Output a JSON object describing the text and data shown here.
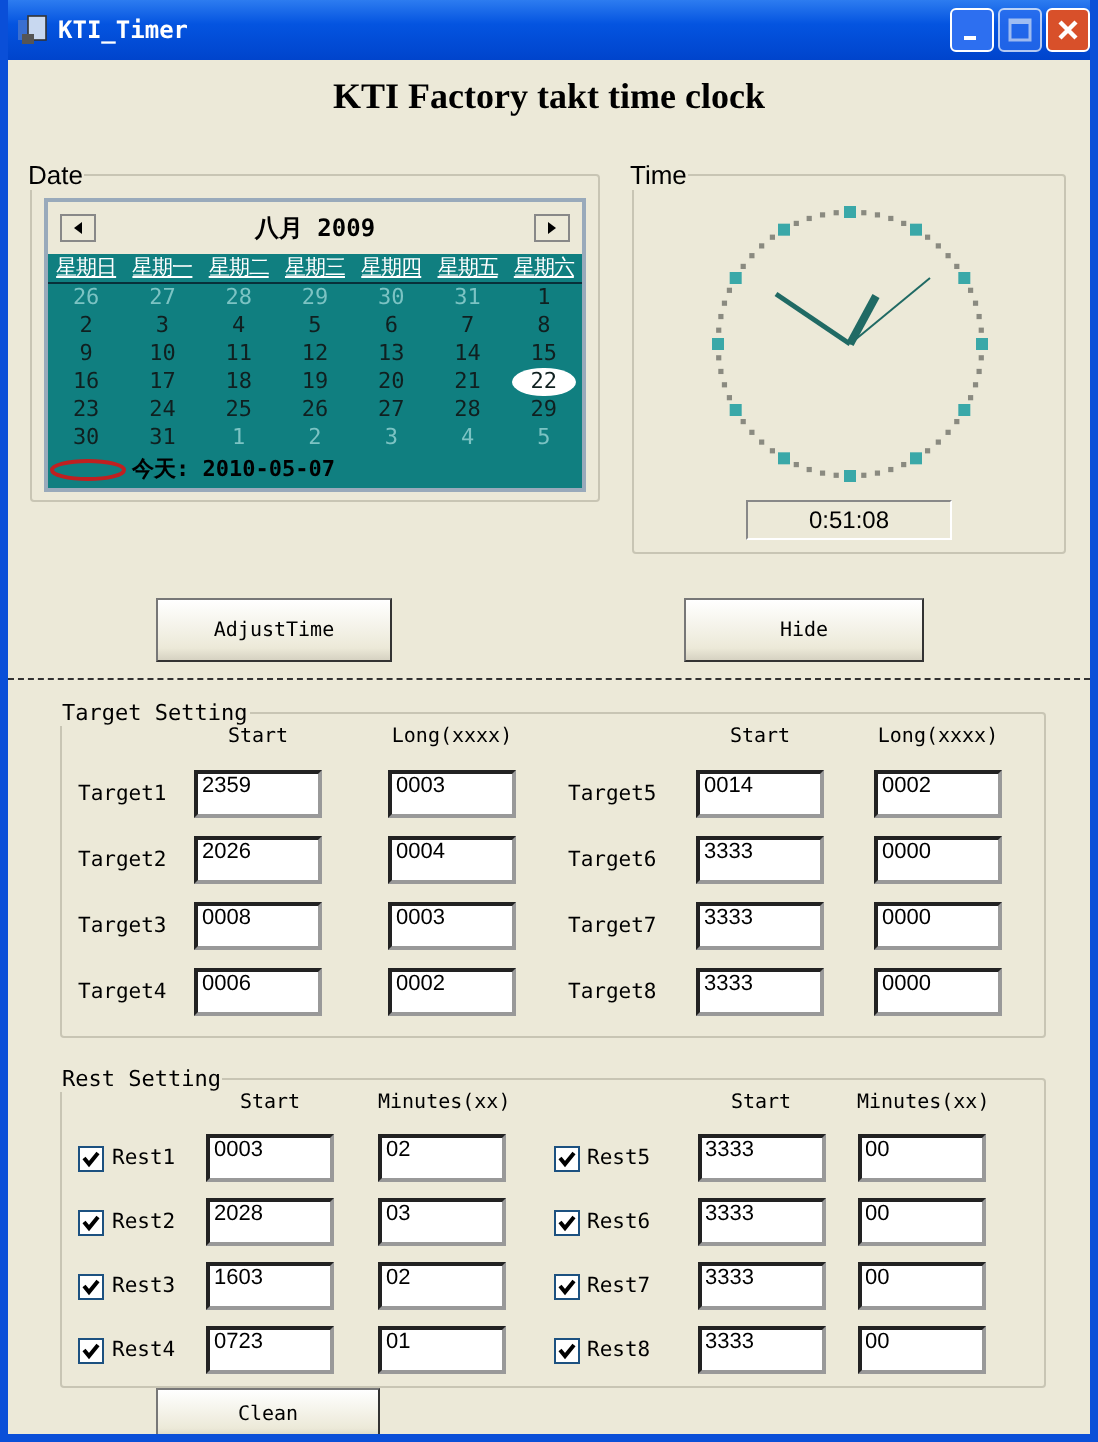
{
  "window": {
    "title": "KTI_Timer"
  },
  "heading": "KTI Factory takt time clock",
  "date_group": {
    "title": "Date",
    "calendar": {
      "month_label": "八月 2009",
      "weekdays": [
        "星期日",
        "星期一",
        "星期二",
        "星期三",
        "星期四",
        "星期五",
        "星期六"
      ],
      "weeks": [
        [
          {
            "text": "26",
            "other_month": true,
            "selected": false
          },
          {
            "text": "27",
            "other_month": true,
            "selected": false
          },
          {
            "text": "28",
            "other_month": true,
            "selected": false
          },
          {
            "text": "29",
            "other_month": true,
            "selected": false
          },
          {
            "text": "30",
            "other_month": true,
            "selected": false
          },
          {
            "text": "31",
            "other_month": true,
            "selected": false
          },
          {
            "text": "1",
            "other_month": false,
            "selected": false
          }
        ],
        [
          {
            "text": "2",
            "other_month": false,
            "selected": false
          },
          {
            "text": "3",
            "other_month": false,
            "selected": false
          },
          {
            "text": "4",
            "other_month": false,
            "selected": false
          },
          {
            "text": "5",
            "other_month": false,
            "selected": false
          },
          {
            "text": "6",
            "other_month": false,
            "selected": false
          },
          {
            "text": "7",
            "other_month": false,
            "selected": false
          },
          {
            "text": "8",
            "other_month": false,
            "selected": false
          }
        ],
        [
          {
            "text": "9",
            "other_month": false,
            "selected": false
          },
          {
            "text": "10",
            "other_month": false,
            "selected": false
          },
          {
            "text": "11",
            "other_month": false,
            "selected": false
          },
          {
            "text": "12",
            "other_month": false,
            "selected": false
          },
          {
            "text": "13",
            "other_month": false,
            "selected": false
          },
          {
            "text": "14",
            "other_month": false,
            "selected": false
          },
          {
            "text": "15",
            "other_month": false,
            "selected": false
          }
        ],
        [
          {
            "text": "16",
            "other_month": false,
            "selected": false
          },
          {
            "text": "17",
            "other_month": false,
            "selected": false
          },
          {
            "text": "18",
            "other_month": false,
            "selected": false
          },
          {
            "text": "19",
            "other_month": false,
            "selected": false
          },
          {
            "text": "20",
            "other_month": false,
            "selected": false
          },
          {
            "text": "21",
            "other_month": false,
            "selected": false
          },
          {
            "text": "22",
            "other_month": false,
            "selected": true
          }
        ],
        [
          {
            "text": "23",
            "other_month": false,
            "selected": false
          },
          {
            "text": "24",
            "other_month": false,
            "selected": false
          },
          {
            "text": "25",
            "other_month": false,
            "selected": false
          },
          {
            "text": "26",
            "other_month": false,
            "selected": false
          },
          {
            "text": "27",
            "other_month": false,
            "selected": false
          },
          {
            "text": "28",
            "other_month": false,
            "selected": false
          },
          {
            "text": "29",
            "other_month": false,
            "selected": false
          }
        ],
        [
          {
            "text": "30",
            "other_month": false,
            "selected": false
          },
          {
            "text": "31",
            "other_month": false,
            "selected": false
          },
          {
            "text": "1",
            "other_month": true,
            "selected": false
          },
          {
            "text": "2",
            "other_month": true,
            "selected": false
          },
          {
            "text": "3",
            "other_month": true,
            "selected": false
          },
          {
            "text": "4",
            "other_month": true,
            "selected": false
          },
          {
            "text": "5",
            "other_month": true,
            "selected": false
          }
        ]
      ],
      "today": "今天: 2010-05-07"
    }
  },
  "time_group": {
    "title": "Time",
    "display": "0:51:08"
  },
  "buttons": [
    "AdjustTime",
    "Hide"
  ],
  "target_setting": {
    "title": "Target Setting",
    "halves": [
      {
        "headers": [
          "Start",
          "Long(xxxx)"
        ],
        "rows": [
          {
            "label": "Target1",
            "start": "2359",
            "long": "0003"
          },
          {
            "label": "Target2",
            "start": "2026",
            "long": "0004"
          },
          {
            "label": "Target3",
            "start": "0008",
            "long": "0003"
          },
          {
            "label": "Target4",
            "start": "0006",
            "long": "0002"
          }
        ]
      },
      {
        "headers": [
          "Start",
          "Long(xxxx)"
        ],
        "rows": [
          {
            "label": "Target5",
            "start": "0014",
            "long": "0002"
          },
          {
            "label": "Target6",
            "start": "3333",
            "long": "0000"
          },
          {
            "label": "Target7",
            "start": "3333",
            "long": "0000"
          },
          {
            "label": "Target8",
            "start": "3333",
            "long": "0000"
          }
        ]
      }
    ]
  },
  "rest_setting": {
    "title": "Rest Setting",
    "halves": [
      {
        "headers": [
          "Start",
          "Minutes(xx)"
        ],
        "rows": [
          {
            "label": "Rest1",
            "checked": true,
            "start": "0003",
            "minutes": "02"
          },
          {
            "label": "Rest2",
            "checked": true,
            "start": "2028",
            "minutes": "03"
          },
          {
            "label": "Rest3",
            "checked": true,
            "start": "1603",
            "minutes": "02"
          },
          {
            "label": "Rest4",
            "checked": true,
            "start": "0723",
            "minutes": "01"
          }
        ]
      },
      {
        "headers": [
          "Start",
          "Minutes(xx)"
        ],
        "rows": [
          {
            "label": "Rest5",
            "checked": true,
            "start": "3333",
            "minutes": "00"
          },
          {
            "label": "Rest6",
            "checked": true,
            "start": "3333",
            "minutes": "00"
          },
          {
            "label": "Rest7",
            "checked": true,
            "start": "3333",
            "minutes": "00"
          },
          {
            "label": "Rest8",
            "checked": true,
            "start": "3333",
            "minutes": "00"
          }
        ]
      }
    ]
  },
  "clean_button": "Clean"
}
